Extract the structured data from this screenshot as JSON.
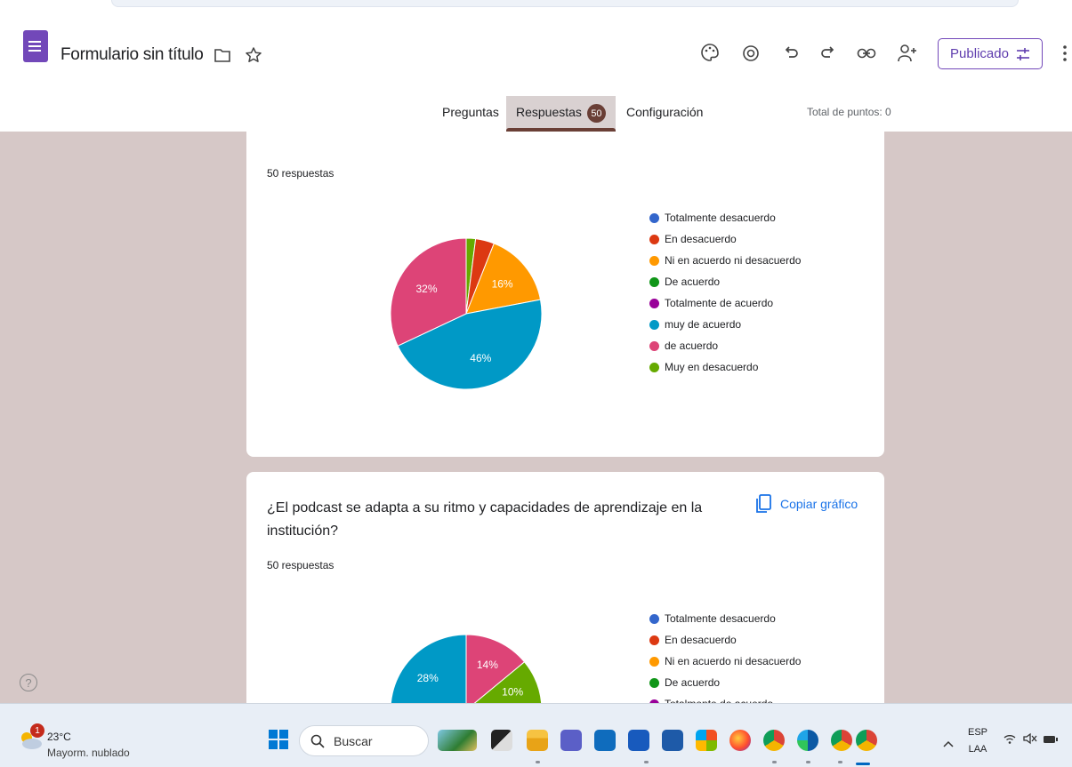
{
  "header": {
    "title": "Formulario sin título",
    "publish_label": "Publicado",
    "icons": [
      "folder-icon",
      "star-icon",
      "palette-icon",
      "preview-icon",
      "undo-icon",
      "redo-icon",
      "link-icon",
      "add-collaborator-icon",
      "more-vert-icon"
    ]
  },
  "tabs": {
    "questions": "Preguntas",
    "responses": "Respuestas",
    "responses_count": "50",
    "settings": "Configuración",
    "points": "Total de puntos: 0"
  },
  "colors": {
    "accent": "#7248b9",
    "tab_accent": "#6a3f36",
    "background": "#d6c8c7"
  },
  "cards": [
    {
      "responses": "50 respuestas",
      "chart_data": {
        "type": "pie",
        "categories": [
          "Totalmente desacuerdo",
          "En desacuerdo",
          "Ni en acuerdo ni desacuerdo",
          "De acuerdo",
          "Totalmente de acuerdo",
          "muy de acuerdo",
          "de acuerdo",
          "Muy en desacuerdo"
        ],
        "values": [
          0,
          4,
          16,
          0,
          0,
          46,
          32,
          2
        ],
        "labels": [
          "",
          "",
          "16%",
          "",
          "",
          "46%",
          "32%",
          ""
        ],
        "colors": [
          "#3366cc",
          "#dc3912",
          "#ff9900",
          "#109618",
          "#990099",
          "#0099c6",
          "#dd4477",
          "#66aa00"
        ],
        "legend": "right"
      }
    },
    {
      "question": "¿El podcast se adapta a su ritmo y capacidades de aprendizaje en la institución?",
      "copy_label": "Copiar gráfico",
      "responses": "50 respuestas",
      "chart_data": {
        "type": "pie",
        "categories": [
          "Totalmente desacuerdo",
          "En desacuerdo",
          "Ni en acuerdo ni desacuerdo",
          "De acuerdo",
          "Totalmente de acuerdo"
        ],
        "visible_slices": [
          {
            "series": "#dd4477",
            "value": 14,
            "label": "14%"
          },
          {
            "series": "#66aa00",
            "value": 10,
            "label": "10%"
          },
          {
            "series": "#0099c6",
            "value": 28,
            "label": "28%"
          }
        ],
        "colors": [
          "#3366cc",
          "#dc3912",
          "#ff9900",
          "#109618",
          "#990099"
        ],
        "legend": "right"
      }
    }
  ],
  "taskbar": {
    "weather_badge": "1",
    "temperature": "23°C",
    "weather_desc": "Mayorm. nublado",
    "search_label": "Buscar",
    "lang_top": "ESP",
    "lang_bottom": "LAA"
  }
}
